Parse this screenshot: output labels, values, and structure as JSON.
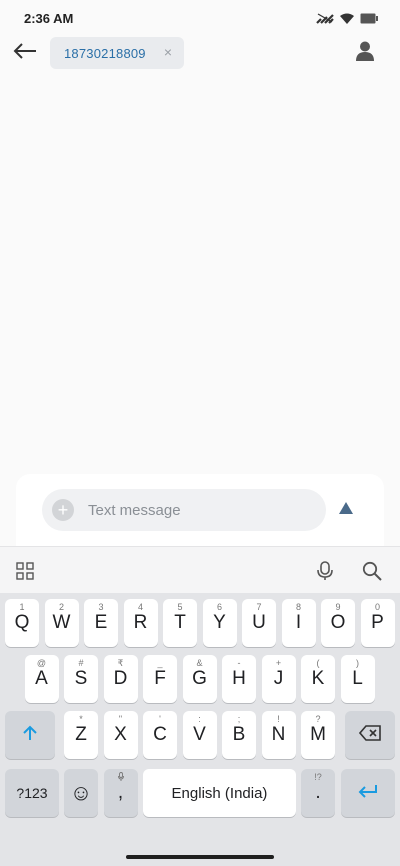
{
  "status_bar": {
    "time": "2:36 AM"
  },
  "app_bar": {
    "recipient": "18730218809",
    "chip_close": "×"
  },
  "composer": {
    "placeholder": "Text message",
    "add_symbol": "+"
  },
  "keyboard": {
    "row1": [
      {
        "label": "Q",
        "hint": "1"
      },
      {
        "label": "W",
        "hint": "2"
      },
      {
        "label": "E",
        "hint": "3"
      },
      {
        "label": "R",
        "hint": "4"
      },
      {
        "label": "T",
        "hint": "5"
      },
      {
        "label": "Y",
        "hint": "6"
      },
      {
        "label": "U",
        "hint": "7"
      },
      {
        "label": "I",
        "hint": "8"
      },
      {
        "label": "O",
        "hint": "9"
      },
      {
        "label": "P",
        "hint": "0"
      }
    ],
    "row2": [
      {
        "label": "A",
        "hint": "@"
      },
      {
        "label": "S",
        "hint": "#"
      },
      {
        "label": "D",
        "hint": "₹"
      },
      {
        "label": "F",
        "hint": "_"
      },
      {
        "label": "G",
        "hint": "&"
      },
      {
        "label": "H",
        "hint": "-"
      },
      {
        "label": "J",
        "hint": "+"
      },
      {
        "label": "K",
        "hint": "("
      },
      {
        "label": "L",
        "hint": ")"
      }
    ],
    "row3": [
      {
        "label": "Z",
        "hint": "*"
      },
      {
        "label": "X",
        "hint": "\""
      },
      {
        "label": "C",
        "hint": "'"
      },
      {
        "label": "V",
        "hint": ":"
      },
      {
        "label": "B",
        "hint": ";"
      },
      {
        "label": "N",
        "hint": "!"
      },
      {
        "label": "M",
        "hint": "?"
      }
    ],
    "symbols_key": "?123",
    "comma_key": ",",
    "space_key": "English (India)",
    "period_key": ".",
    "period_hint": "!?",
    "emoji_glyph": "☺"
  },
  "colors": {
    "accent": "#1a9be0",
    "send": "#4a6a8a",
    "recipient_text": "#2a6fa7"
  },
  "icons": {
    "status": [
      "signal-off-icon",
      "wifi-icon",
      "battery-icon"
    ],
    "app_bar": [
      "back-arrow-icon",
      "contact-icon"
    ],
    "composer": [
      "add-attachment-icon",
      "send-icon"
    ],
    "toolbar": [
      "apps-grid-icon",
      "microphone-icon",
      "search-icon"
    ],
    "keyboard": [
      "shift-icon",
      "backspace-icon",
      "emoji-icon",
      "enter-icon"
    ]
  }
}
